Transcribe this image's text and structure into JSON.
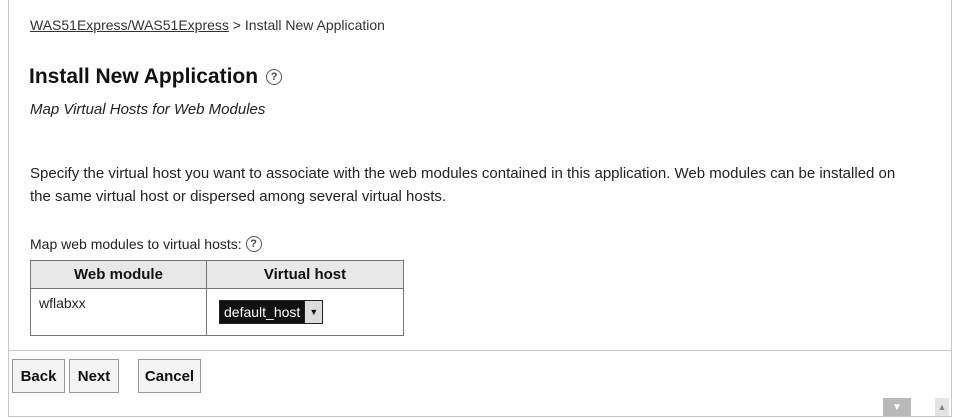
{
  "breadcrumb": {
    "link": "WAS51Express/WAS51Express",
    "separator": " > ",
    "current": "Install New Application"
  },
  "header": {
    "title": "Install New Application",
    "help_icon": "question-circle-icon"
  },
  "subtitle": "Map Virtual Hosts for Web Modules",
  "description": "Specify the virtual host you want to associate with the web modules contained in this application. Web modules can be installed on the same virtual host or dispersed among several virtual hosts.",
  "mapping": {
    "label": "Map web modules to virtual hosts:",
    "help_icon": "question-circle-icon",
    "columns": [
      "Web module",
      "Virtual host"
    ],
    "rows": [
      {
        "module": "wflabxx",
        "virtual_host": "default_host"
      }
    ]
  },
  "buttons": {
    "back": "Back",
    "next": "Next",
    "cancel": "Cancel"
  },
  "scroll": {
    "down_icon": "scroll-down-icon",
    "up_icon": "scroll-up-icon"
  }
}
